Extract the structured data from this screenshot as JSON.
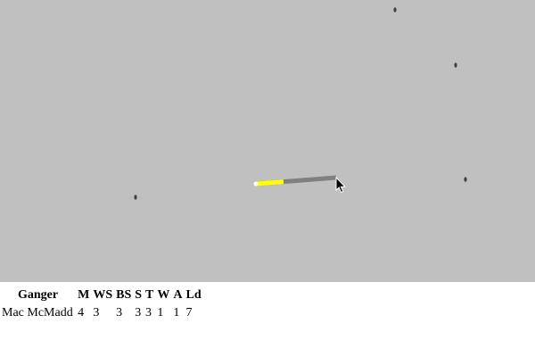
{
  "colors": {
    "board_background": "#c0c0c0",
    "panel_background": "#ffffff",
    "movement_line_covered": "#ffff00",
    "movement_line_remaining": "#808080",
    "marker": "#404040"
  },
  "stats_table": {
    "headers": [
      "Ganger",
      "M",
      "WS",
      "BS",
      "S",
      "T",
      "W",
      "A",
      "Ld"
    ],
    "rows": [
      {
        "name": "Mac McMadd",
        "values": [
          "4",
          "3",
          "3",
          "3",
          "3",
          "1",
          "1",
          "7"
        ]
      }
    ]
  },
  "icons": {
    "cursor": "mouse-pointer-icon",
    "marker": "terrain-marker-icon"
  }
}
